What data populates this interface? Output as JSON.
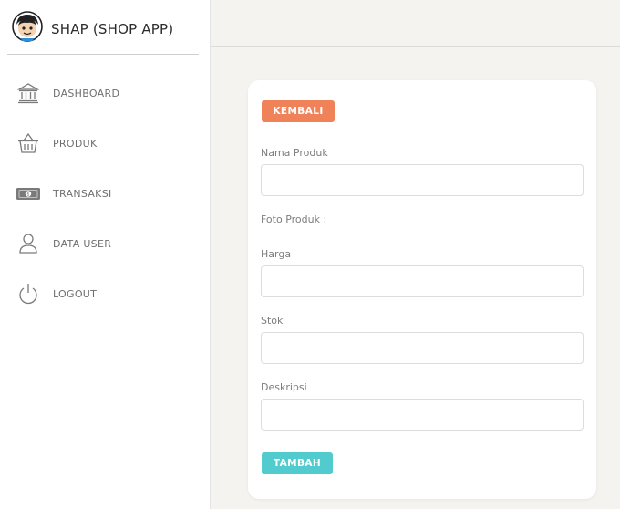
{
  "brand": {
    "name": "SHAP (SHOP APP)"
  },
  "sidebar": {
    "items": [
      {
        "label": "DASHBOARD",
        "icon": "bank-icon"
      },
      {
        "label": "PRODUK",
        "icon": "basket-icon"
      },
      {
        "label": "TRANSAKSI",
        "icon": "money-icon"
      },
      {
        "label": "DATA USER",
        "icon": "user-icon"
      },
      {
        "label": "LOGOUT",
        "icon": "power-icon"
      }
    ]
  },
  "form": {
    "back_label": "KEMBALI",
    "nama_label": "Nama Produk",
    "nama_value": "",
    "foto_label": "Foto Produk :",
    "harga_label": "Harga",
    "harga_value": "",
    "stok_label": "Stok",
    "stok_value": "",
    "deskripsi_label": "Deskripsi",
    "deskripsi_value": "",
    "submit_label": "TAMBAH"
  },
  "colors": {
    "back_button": "#f0825a",
    "submit_button": "#51cbce",
    "page_background": "#f4f3ef"
  }
}
